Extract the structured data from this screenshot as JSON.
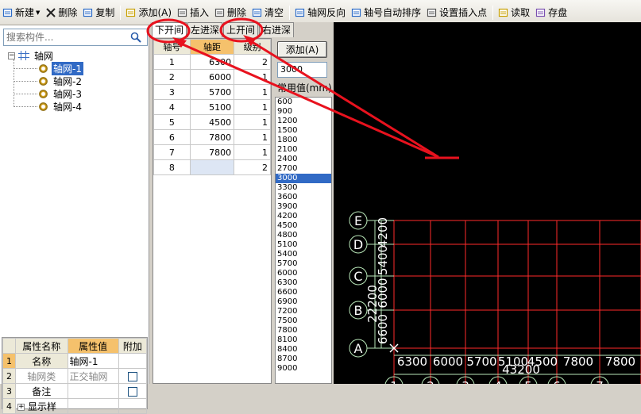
{
  "toolbar": {
    "items": [
      {
        "label": "新建",
        "icon": "new-icon",
        "dropdown": true
      },
      {
        "label": "删除",
        "icon": "delete-icon"
      },
      {
        "label": "复制",
        "icon": "copy-icon"
      },
      {
        "label": "添加(A)",
        "icon": "add-icon"
      },
      {
        "label": "插入",
        "icon": "insert-icon"
      },
      {
        "label": "删除",
        "icon": "delete-axis-icon"
      },
      {
        "label": "清空",
        "icon": "clear-icon"
      },
      {
        "label": "轴网反向",
        "icon": "grid-reverse-icon"
      },
      {
        "label": "轴号自动排序",
        "icon": "auto-sort-icon"
      },
      {
        "label": "设置插入点",
        "icon": "insert-point-icon"
      },
      {
        "label": "读取",
        "icon": "read-icon"
      },
      {
        "label": "存盘",
        "icon": "save-icon"
      }
    ]
  },
  "search": {
    "placeholder": "搜索构件..."
  },
  "tree": {
    "root": "轴网",
    "children": [
      "轴网-1",
      "轴网-2",
      "轴网-3",
      "轴网-4"
    ],
    "selected": "轴网-1"
  },
  "properties": {
    "headers": [
      "属性名称",
      "属性值",
      "附加"
    ],
    "rows": [
      {
        "num": "1",
        "name": "名称",
        "value": "轴网-1"
      },
      {
        "num": "2",
        "name": "轴网类",
        "value": "正交轴网"
      },
      {
        "num": "3",
        "name": "备注",
        "value": ""
      },
      {
        "num": "4",
        "name": "显示样",
        "value": ""
      }
    ]
  },
  "tabs": [
    "下开间",
    "左进深",
    "上开间",
    "右进深"
  ],
  "axis_table": {
    "headers": [
      "轴号",
      "轴距",
      "级别"
    ],
    "rows": [
      {
        "no": "1",
        "dist": "6300",
        "level": "2"
      },
      {
        "no": "2",
        "dist": "6000",
        "level": "1"
      },
      {
        "no": "3",
        "dist": "5700",
        "level": "1"
      },
      {
        "no": "4",
        "dist": "5100",
        "level": "1"
      },
      {
        "no": "5",
        "dist": "4500",
        "level": "1"
      },
      {
        "no": "6",
        "dist": "7800",
        "level": "1"
      },
      {
        "no": "7",
        "dist": "7800",
        "level": "1"
      },
      {
        "no": "8",
        "dist": "",
        "level": "2"
      }
    ]
  },
  "add_button": "添加(A)",
  "value_input": "3000",
  "common_label": "常用值(mm)",
  "common_values": [
    "600",
    "900",
    "1200",
    "1500",
    "1800",
    "2100",
    "2400",
    "2700",
    "3000",
    "3300",
    "3600",
    "3900",
    "4200",
    "4500",
    "4800",
    "5100",
    "5400",
    "5700",
    "6000",
    "6300",
    "6600",
    "6900",
    "7200",
    "7500",
    "7800",
    "8100",
    "8400",
    "8700",
    "9000"
  ],
  "common_selected": "3000",
  "canvas": {
    "row_axes": [
      "E",
      "D",
      "C",
      "B",
      "A"
    ],
    "col_axes": [
      "1",
      "2",
      "3",
      "4",
      "5",
      "6",
      "7"
    ],
    "bottom_dims": [
      "6300",
      "6000",
      "5700",
      "5100",
      "4500",
      "7800",
      "7800"
    ],
    "bottom_total": "43200",
    "left_dims": [
      "6600",
      "6000",
      "5400",
      "4200"
    ],
    "left_total": "22200"
  },
  "colors": {
    "annotation": "#e8121e",
    "grid_line": "#ff2a2a",
    "axis_circle": "#b8e6b8",
    "tree_select": "#316ac5",
    "header_highlight": "#f5c16c"
  }
}
